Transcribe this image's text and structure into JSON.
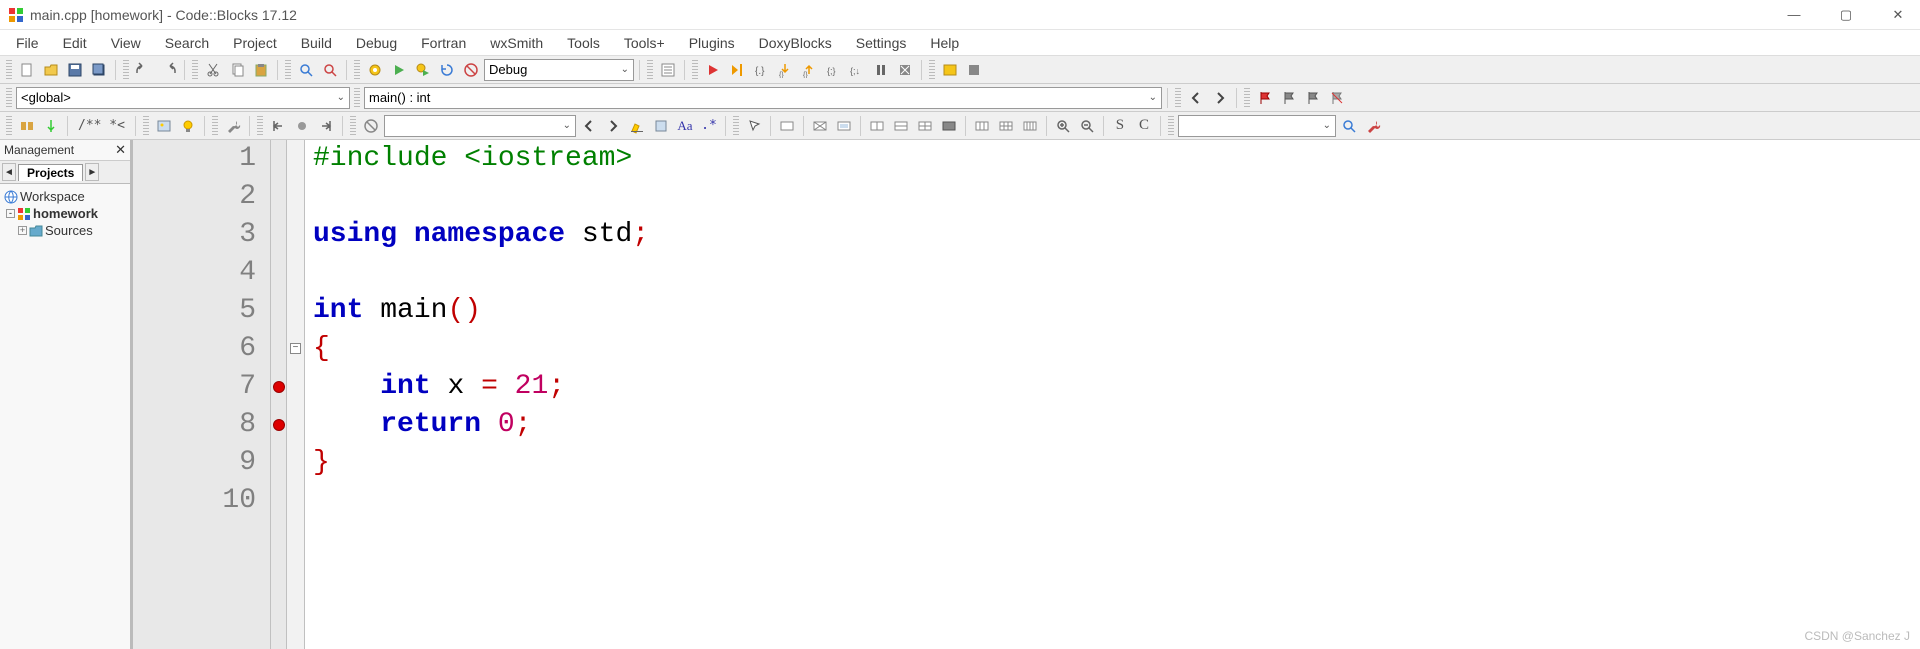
{
  "title": "main.cpp [homework] - Code::Blocks 17.12",
  "menu": [
    "File",
    "Edit",
    "View",
    "Search",
    "Project",
    "Build",
    "Debug",
    "Fortran",
    "wxSmith",
    "Tools",
    "Tools+",
    "Plugins",
    "DoxyBlocks",
    "Settings",
    "Help"
  ],
  "row1": {
    "config": "Debug"
  },
  "row2": {
    "scope": "<global>",
    "func": "main() : int"
  },
  "row3": {
    "comment": "/**  *<"
  },
  "mgmt": {
    "title": "Management",
    "tab": "Projects",
    "tree": {
      "root": "Workspace",
      "proj": "homework",
      "folder": "Sources"
    }
  },
  "editor": {
    "lines": [
      "1",
      "2",
      "3",
      "4",
      "5",
      "6",
      "7",
      "8",
      "9",
      "10"
    ],
    "breakpoints": [
      7,
      8
    ],
    "fold_open_at": 6,
    "code": {
      "l1a": "#include <iostream>",
      "l3_kw1": "using",
      "l3_kw2": "namespace",
      "l3_id": "std",
      "l3_sc": ";",
      "l5_kw1": "int",
      "l5_id": "main",
      "l5_par": "()",
      "l6": "{",
      "l7_kw": "int",
      "l7_id": " x ",
      "l7_eq": "=",
      "l7_num": " 21",
      "l7_sc": ";",
      "l8_kw": "return",
      "l8_num": " 0",
      "l8_sc": ";",
      "l9": "}"
    }
  },
  "watermark": "CSDN @Sanchez J"
}
